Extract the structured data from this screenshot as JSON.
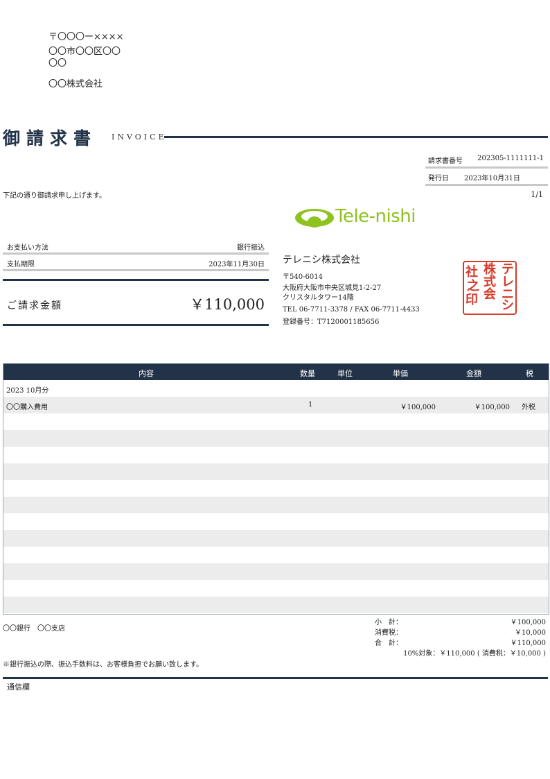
{
  "recipient": {
    "postal": "〒〇〇〇ー××××",
    "city": "〇〇市〇〇区〇〇",
    "street": "〇〇",
    "company": "〇〇株式会社"
  },
  "header": {
    "title": "御請求書",
    "subtitle": "INVOICE"
  },
  "meta": {
    "invoice_no_label": "請求書番号",
    "invoice_no": "202305-1111111-1",
    "issue_label": "発行日",
    "issue_date": "2023年10月31日"
  },
  "greeting": "下記の通り御請求申し上げます。",
  "page": "1/1",
  "payment": {
    "method_label": "お支払い方法",
    "method_value": "銀行振込",
    "due_label": "支払期限",
    "due_value": "2023年11月30日"
  },
  "total": {
    "label": "ご請求金額",
    "amount": "￥110,000"
  },
  "company": {
    "logo_text": "Tele-nishi",
    "name": "テレニシ株式会社",
    "postal": "〒540-6014",
    "address1": "大阪府大阪市中央区城見1-2-27",
    "address2": "クリスタルタワー14階",
    "phone": "TEL 06-7711-3378 / FAX 06-7711-4433",
    "reg_no": "登録番号：T7120001185656",
    "stamp_chars": [
      "テ",
      "レ",
      "ニ",
      "シ",
      "株",
      "式",
      "会",
      "社",
      "印",
      "之"
    ]
  },
  "table": {
    "headers": [
      "内容",
      "数量",
      "単位",
      "単価",
      "金額",
      "税"
    ],
    "rows": [
      {
        "desc": "2023 10月分",
        "qty": "",
        "unit": "",
        "price": "",
        "amount": "",
        "tax": ""
      },
      {
        "desc": "〇〇購入費用",
        "qty": "1",
        "unit": "",
        "price": "￥100,000",
        "amount": "￥100,000",
        "tax": "外税"
      },
      {
        "desc": "",
        "qty": "",
        "unit": "",
        "price": "",
        "amount": "",
        "tax": ""
      },
      {
        "desc": "",
        "qty": "",
        "unit": "",
        "price": "",
        "amount": "",
        "tax": ""
      },
      {
        "desc": "",
        "qty": "",
        "unit": "",
        "price": "",
        "amount": "",
        "tax": ""
      },
      {
        "desc": "",
        "qty": "",
        "unit": "",
        "price": "",
        "amount": "",
        "tax": ""
      },
      {
        "desc": "",
        "qty": "",
        "unit": "",
        "price": "",
        "amount": "",
        "tax": ""
      },
      {
        "desc": "",
        "qty": "",
        "unit": "",
        "price": "",
        "amount": "",
        "tax": ""
      },
      {
        "desc": "",
        "qty": "",
        "unit": "",
        "price": "",
        "amount": "",
        "tax": ""
      },
      {
        "desc": "",
        "qty": "",
        "unit": "",
        "price": "",
        "amount": "",
        "tax": ""
      },
      {
        "desc": "",
        "qty": "",
        "unit": "",
        "price": "",
        "amount": "",
        "tax": ""
      },
      {
        "desc": "",
        "qty": "",
        "unit": "",
        "price": "",
        "amount": "",
        "tax": ""
      },
      {
        "desc": "",
        "qty": "",
        "unit": "",
        "price": "",
        "amount": "",
        "tax": ""
      },
      {
        "desc": "",
        "qty": "",
        "unit": "",
        "price": "",
        "amount": "",
        "tax": ""
      }
    ]
  },
  "bank": "〇〇銀行　〇〇支店",
  "summary": {
    "subtotal_label": "小　計：",
    "subtotal": "￥100,000",
    "tax_label": "消費税：",
    "tax": "￥10,000",
    "total_label": "合　計：",
    "total": "￥110,000",
    "breakdown": "10%対象：￥110,000 ( 消費税：￥10,000 )"
  },
  "note": "※銀行振込の際、振込手数料は、お客様負担でお願い致します。",
  "memo_label": "通信欄",
  "colors": {
    "navy": "#223349",
    "logo_green": "#8dc21f",
    "stamp_red": "#d63a2a",
    "row_stripe": "#ececec"
  }
}
